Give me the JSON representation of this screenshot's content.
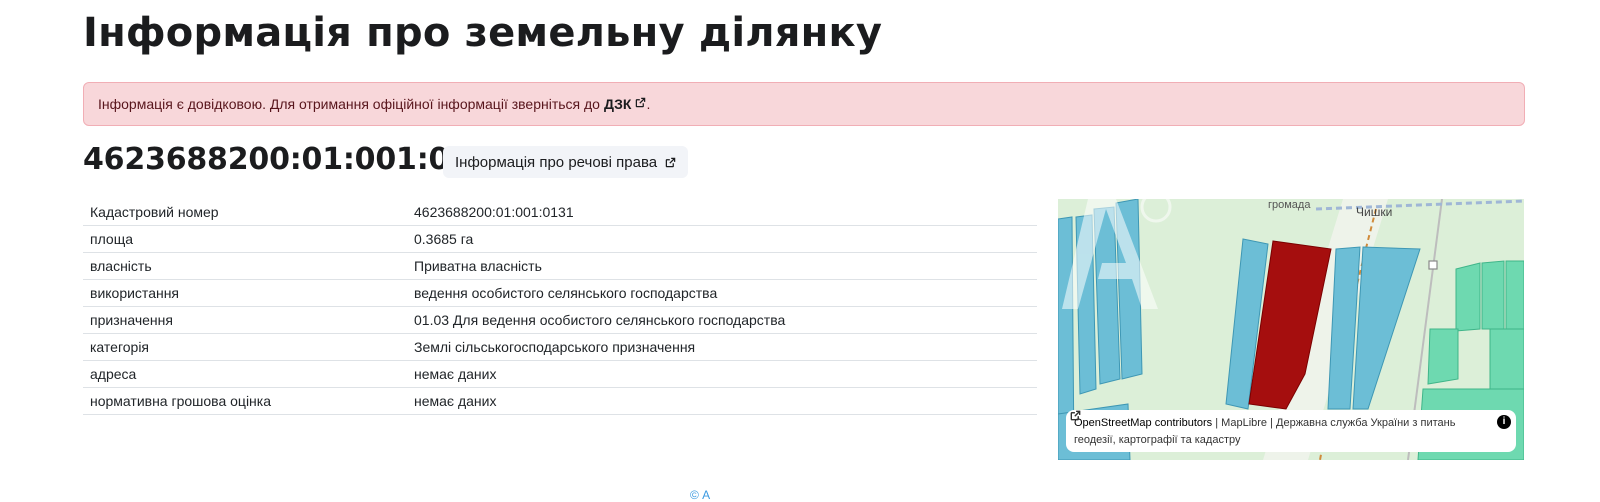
{
  "page": {
    "title": "Інформація про земельну ділянку"
  },
  "alert": {
    "text": "Інформація є довідковою. Для отримання офіційної інформації зверніться до",
    "link_label": "ДЗК",
    "suffix": "."
  },
  "parcel": {
    "number": "4623688200:01:001:0131",
    "rights_button_label": "Інформація про речові права"
  },
  "details": [
    {
      "label": "Кадастровий номер",
      "value": "4623688200:01:001:0131"
    },
    {
      "label": "площа",
      "value": "0.3685 га"
    },
    {
      "label": "власність",
      "value": "Приватна власність"
    },
    {
      "label": "використання",
      "value": "ведення особистого селянського господарства"
    },
    {
      "label": "призначення",
      "value": "01.03 Для ведення особистого селянського господарства"
    },
    {
      "label": "категорія",
      "value": "Землі сільськогосподарського призначення"
    },
    {
      "label": "адреса",
      "value": "немає даних"
    },
    {
      "label": "нормативна грошова оцінка",
      "value": "немає даних"
    }
  ],
  "map": {
    "labels": {
      "community": "громада",
      "village": "Чишки"
    },
    "attribution": {
      "osm": "OpenStreetMap contributors",
      "separator1": "|",
      "maplibre": "MapLibre",
      "separator2": "|",
      "agency": "Державна служба України з питань геодезії, картографії та кадастру",
      "info_glyph": "i"
    },
    "colors": {
      "selected_parcel": "#a50e0e",
      "parcel_blue": "#6cbed6",
      "parcel_green": "#6ed9b0",
      "background": "#dcefd8"
    }
  },
  "footer": {
    "partial_text": "© А"
  }
}
